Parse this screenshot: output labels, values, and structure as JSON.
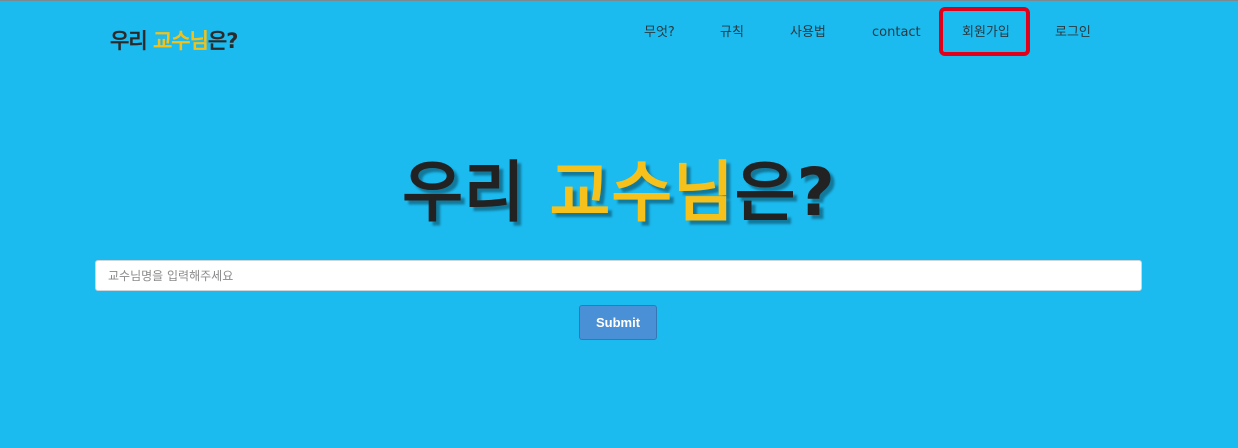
{
  "logo": {
    "part1": "우리 ",
    "accent": "교수님",
    "part2": "은?"
  },
  "nav": {
    "items": [
      {
        "label": "무엇?"
      },
      {
        "label": "규칙"
      },
      {
        "label": "사용법"
      },
      {
        "label": "contact"
      },
      {
        "label": "회원가입",
        "highlighted": true
      },
      {
        "label": "로그인"
      }
    ]
  },
  "hero": {
    "part1": "우리 ",
    "accent": "교수님",
    "part2": "은?"
  },
  "search": {
    "placeholder": "교수님명을 입력해주세요",
    "value": ""
  },
  "submit": {
    "label": "Submit"
  },
  "colors": {
    "background": "#1bbaef",
    "accent": "#f5c11a",
    "text_dark": "#222222",
    "button": "#4a90d6",
    "highlight_box": "#e0001a"
  }
}
